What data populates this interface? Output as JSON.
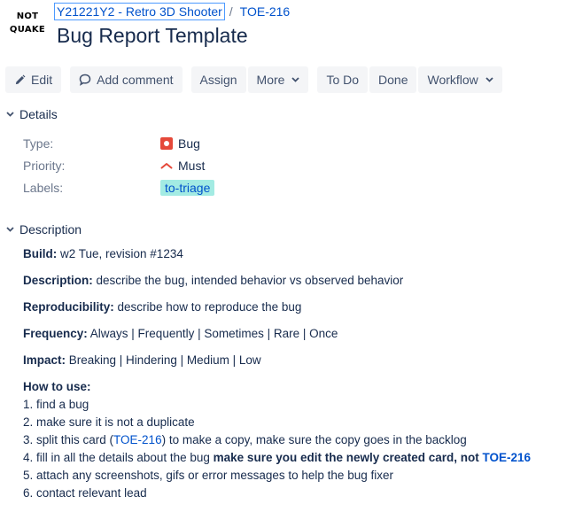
{
  "logo": {
    "line1": "NOT",
    "line2": "QUAKE"
  },
  "breadcrumbs": {
    "project": "Y21221Y2 - Retro 3D Shooter",
    "separator": "/",
    "issue_key": "TOE-216"
  },
  "title": "Bug Report Template",
  "toolbar": {
    "edit": "Edit",
    "add_comment": "Add comment",
    "assign": "Assign",
    "more": "More",
    "todo": "To Do",
    "done": "Done",
    "workflow": "Workflow"
  },
  "details": {
    "heading": "Details",
    "type_label": "Type:",
    "type_value": "Bug",
    "priority_label": "Priority:",
    "priority_value": "Must",
    "labels_label": "Labels:",
    "labels_value": "to-triage"
  },
  "description": {
    "heading": "Description",
    "build_label": "Build:",
    "build_text": " w2 Tue, revision #1234",
    "desc_label": "Description:",
    "desc_text": " describe the bug, intended behavior vs observed behavior",
    "repro_label": "Reproducibility:",
    "repro_text": " describe how to reproduce the bug",
    "freq_label": "Frequency:",
    "freq_text": " Always | Frequently | Sometimes | Rare | Once",
    "impact_label": "Impact:",
    "impact_text": " Breaking | Hindering | Medium | Low",
    "howto_label": "How to use:",
    "step1": "1. find a bug",
    "step2": "2. make sure it is not a duplicate",
    "step3_pre": "3. split this card (",
    "step3_link": "TOE-216",
    "step3_post": ") to make a copy, make sure the copy goes in the backlog",
    "step4_pre": "4. fill in all the details about the bug ",
    "step4_bold": "make sure you edit the newly created card, not ",
    "step4_link": "TOE-216",
    "step5": "5. attach any screenshots, gifs or error messages to help the bug fixer",
    "step6": "6. contact relevant lead"
  },
  "colors": {
    "link": "#0052cc",
    "bug_icon": "#e5493a",
    "label_chip": "#a3ebe3",
    "button_bg": "#f4f5f7"
  }
}
